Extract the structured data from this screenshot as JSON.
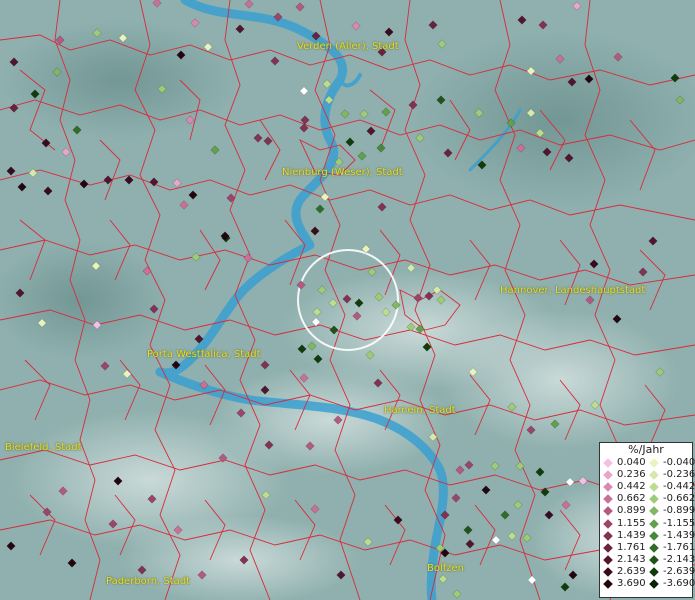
{
  "cities": [
    {
      "name": "Verden (Aller), Stadt"
    },
    {
      "name": "Nienburg (Weser), Stadt"
    },
    {
      "name": "Hannover, Landeshauptstadt"
    },
    {
      "name": "Porta Westfalica, Stadt"
    },
    {
      "name": "Hameln, Stadt"
    },
    {
      "name": "Bielefeld, Stadt"
    },
    {
      "name": "Paderborn, Stadt"
    },
    {
      "name": "Bolfzen"
    }
  ],
  "legend": {
    "title": "%/Jahr",
    "positive": [
      {
        "label": "0.040",
        "color": "#f4c0e4"
      },
      {
        "label": "0.236",
        "color": "#e8a6cc"
      },
      {
        "label": "0.442",
        "color": "#d889b2"
      },
      {
        "label": "0.662",
        "color": "#c87098"
      },
      {
        "label": "0.899",
        "color": "#b45a80"
      },
      {
        "label": "1.155",
        "color": "#9c456a"
      },
      {
        "label": "1.439",
        "color": "#833254"
      },
      {
        "label": "1.761",
        "color": "#6a2240"
      },
      {
        "label": "2.143",
        "color": "#52142e"
      },
      {
        "label": "2.639",
        "color": "#3a0a1e"
      },
      {
        "label": "3.690",
        "color": "#24040f"
      }
    ],
    "negative": [
      {
        "label": "-0.040",
        "color": "#e8f4c0"
      },
      {
        "label": "-0.236",
        "color": "#d4eaa8"
      },
      {
        "label": "-0.442",
        "color": "#bcdd90"
      },
      {
        "label": "-0.662",
        "color": "#9fcb78"
      },
      {
        "label": "-0.899",
        "color": "#80b862"
      },
      {
        "label": "-1.155",
        "color": "#62a04c"
      },
      {
        "label": "-1.439",
        "color": "#488838"
      },
      {
        "label": "-1.761",
        "color": "#306e26"
      },
      {
        "label": "-2.143",
        "color": "#1e5418"
      },
      {
        "label": "-2.639",
        "color": "#103c0c"
      },
      {
        "label": "-3.690",
        "color": "#062406"
      }
    ]
  },
  "colors": {
    "boundary": "#d82a3a",
    "river": "#3aa0d0",
    "terrain": "#8fb0ae"
  }
}
